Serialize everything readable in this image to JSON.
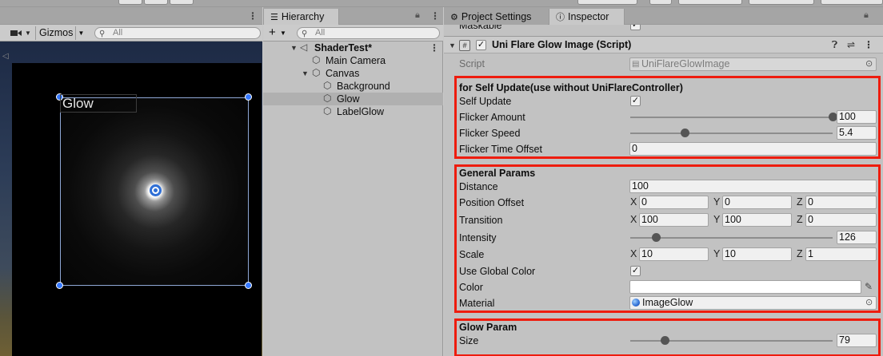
{
  "scene": {
    "gizmos_label": "Gizmos",
    "search_placeholder": "All",
    "label_text": "Glow"
  },
  "hierarchy": {
    "tab_label": "Hierarchy",
    "add_label": "+",
    "search_placeholder": "All",
    "items": [
      {
        "label": "ShaderTest*",
        "bold": true
      },
      {
        "label": "Main Camera"
      },
      {
        "label": "Canvas"
      },
      {
        "label": "Background"
      },
      {
        "label": "Glow",
        "selected": true
      },
      {
        "label": "LabelGlow"
      }
    ]
  },
  "inspector": {
    "tabs": [
      {
        "label": "Project Settings"
      },
      {
        "label": "Inspector",
        "active": true
      }
    ],
    "maskable_label": "Maskable",
    "component": {
      "title": "Uni Flare Glow Image (Script)",
      "enabled": true,
      "script_label": "Script",
      "script_value": "UniFlareGlowImage"
    },
    "self_update": {
      "header": "for Self Update(use without UniFlareController)",
      "self_update_label": "Self Update",
      "self_update_checked": true,
      "flicker_amount_label": "Flicker Amount",
      "flicker_amount_value": "100",
      "flicker_amount_fraction": 1.0,
      "flicker_speed_label": "Flicker Speed",
      "flicker_speed_value": "5.4",
      "flicker_speed_fraction": 0.27,
      "flicker_time_offset_label": "Flicker Time Offset",
      "flicker_time_offset_value": "0"
    },
    "general": {
      "header": "General Params",
      "distance_label": "Distance",
      "distance_value": "100",
      "position_offset_label": "Position Offset",
      "position_offset": {
        "x": "0",
        "y": "0",
        "z": "0"
      },
      "transition_label": "Transition",
      "transition": {
        "x": "100",
        "y": "100",
        "z": "0"
      },
      "intensity_label": "Intensity",
      "intensity_value": "126",
      "intensity_fraction": 0.13,
      "scale_label": "Scale",
      "scale": {
        "x": "10",
        "y": "10",
        "z": "1"
      },
      "use_global_color_label": "Use Global Color",
      "use_global_color_checked": true,
      "color_label": "Color",
      "color_value": "#ffffff",
      "material_label": "Material",
      "material_value": "ImageGlow"
    },
    "glow_param": {
      "header": "Glow Param",
      "size_label": "Size",
      "size_value": "79",
      "size_fraction": 0.17
    },
    "axis_labels": {
      "x": "X",
      "y": "Y",
      "z": "Z"
    }
  },
  "colors": {
    "highlight_box": "#ee1c0e",
    "handle": "#3578ff",
    "selected_row": "#b0b0b0"
  }
}
